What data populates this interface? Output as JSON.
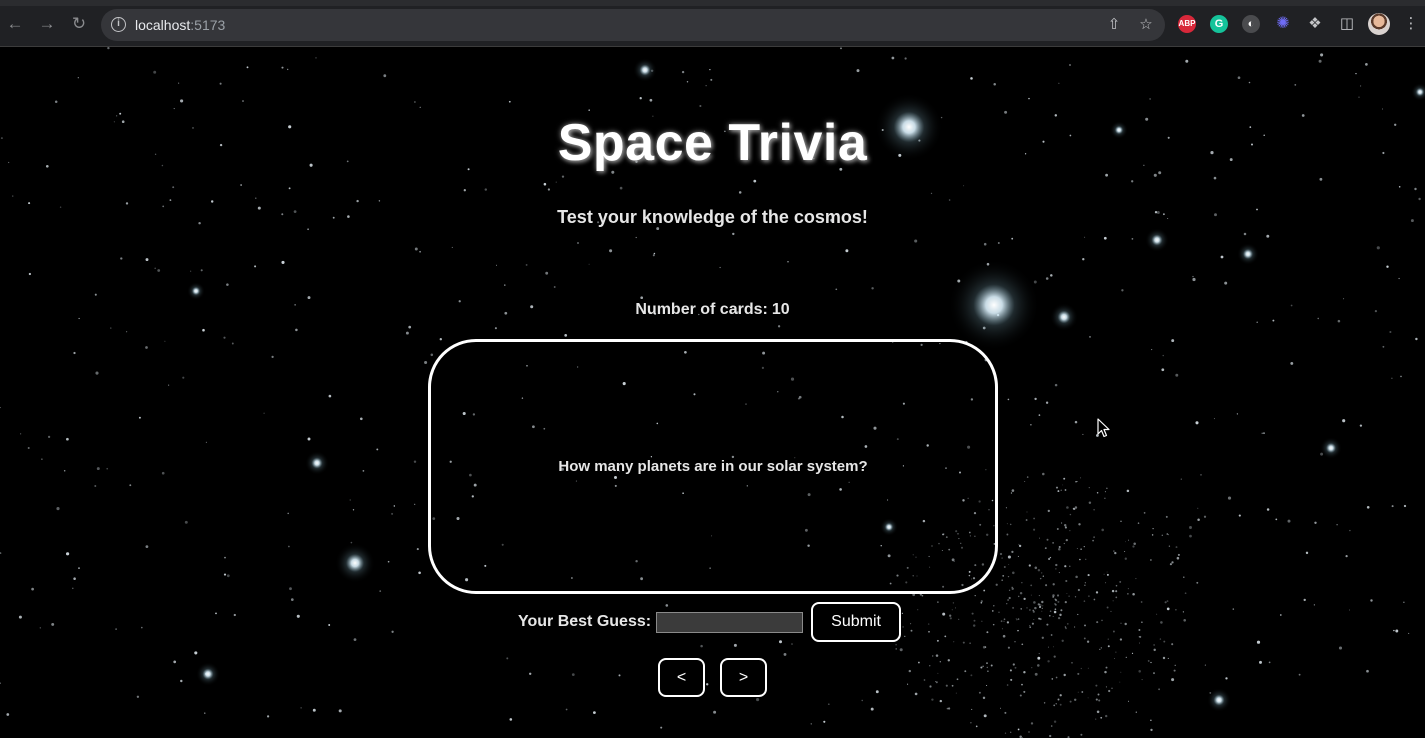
{
  "browser": {
    "url_host": "localhost",
    "url_port": ":5173",
    "extensions": [
      "ABP",
      "G",
      "◐",
      "✺"
    ],
    "icons": {
      "back": "back-arrow-icon",
      "forward": "forward-arrow-icon",
      "reload": "reload-icon",
      "site_info": "info-icon",
      "share": "share-icon",
      "bookmark": "star-icon",
      "extensions": "puzzle-icon",
      "side_panel": "side-panel-icon",
      "menu": "kebab-menu-icon"
    }
  },
  "app": {
    "title": "Space Trivia",
    "subtitle": "Test your knowledge of the cosmos!",
    "card_count_label": "Number of cards:",
    "card_count": "10",
    "card": {
      "question": "How many planets are in our solar system?"
    },
    "guess": {
      "label": "Your Best Guess:",
      "value": "",
      "submit_label": "Submit"
    },
    "navigation": {
      "prev_label": "<",
      "next_label": ">"
    }
  },
  "colors": {
    "background": "#000000",
    "text": "#ffffff",
    "chrome_bg": "#202124",
    "omnibox_bg": "#35363a"
  }
}
